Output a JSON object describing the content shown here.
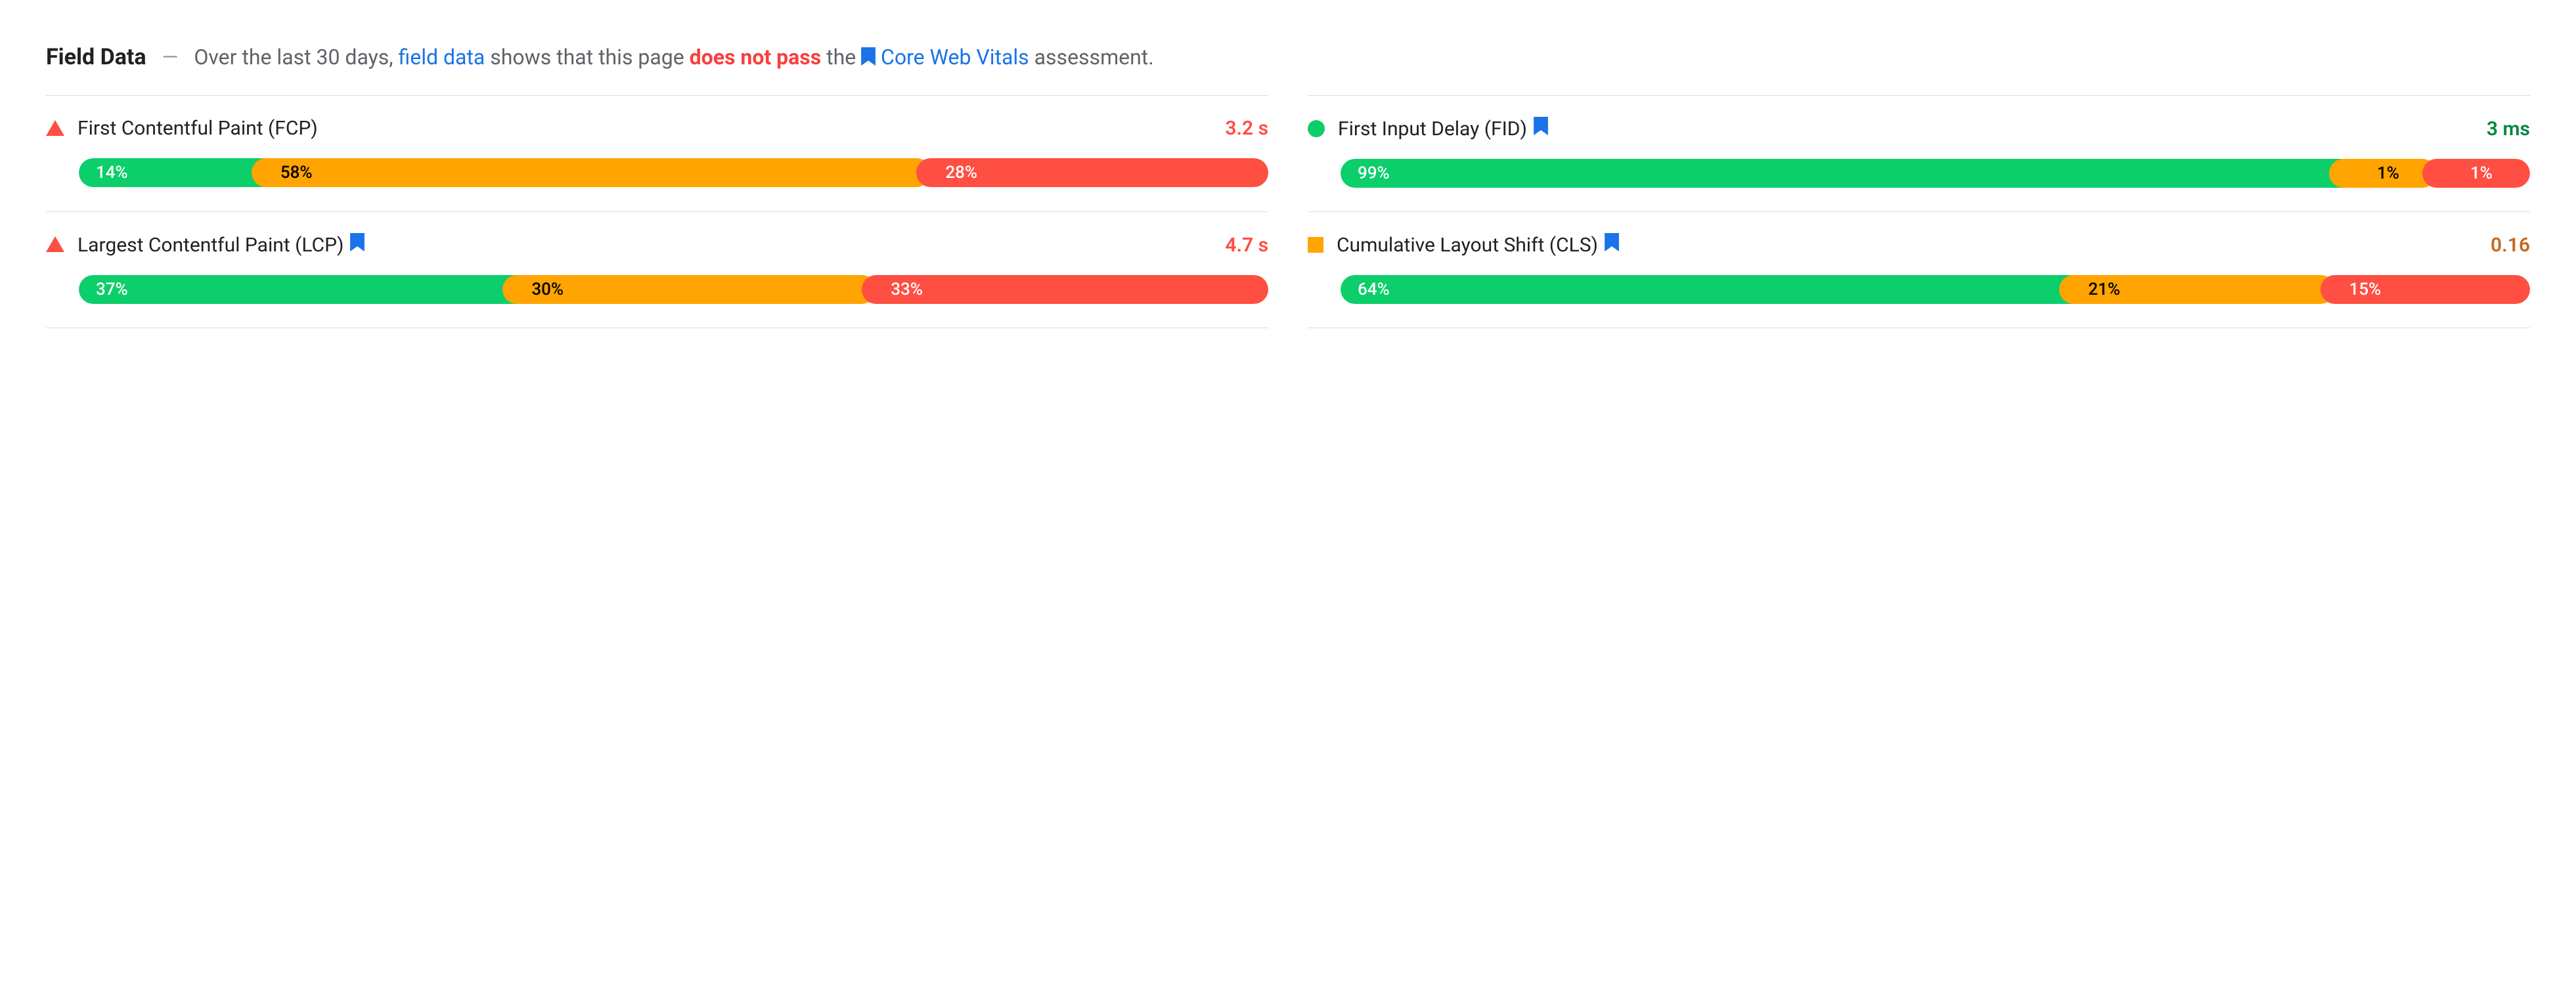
{
  "header": {
    "title": "Field Data",
    "prefix": "Over the last 30 days,",
    "link_field_data": "field data",
    "mid": "shows that this page",
    "status_text": "does not pass",
    "suffix": "the",
    "link_cwv": "Core Web Vitals",
    "tail": "assessment."
  },
  "metrics": [
    {
      "name": "First Contentful Paint (FCP)",
      "status": "poor",
      "value": "3.2 s",
      "value_class": "poor",
      "has_bookmark": false,
      "dist": {
        "good": "14%",
        "avg": "58%",
        "poor": "28%",
        "good_w": 14,
        "avg_w": 58,
        "poor_w": 28
      }
    },
    {
      "name": "First Input Delay (FID)",
      "status": "good",
      "value": "3 ms",
      "value_class": "good",
      "has_bookmark": true,
      "dist": {
        "good": "99%",
        "avg": "1%",
        "poor": "1%",
        "good_w": 86,
        "avg_w": 7,
        "poor_w": 7
      }
    },
    {
      "name": "Largest Contentful Paint (LCP)",
      "status": "poor",
      "value": "4.7 s",
      "value_class": "poor",
      "has_bookmark": true,
      "dist": {
        "good": "37%",
        "avg": "30%",
        "poor": "33%",
        "good_w": 37,
        "avg_w": 30,
        "poor_w": 33
      }
    },
    {
      "name": "Cumulative Layout Shift (CLS)",
      "status": "avg",
      "value": "0.16",
      "value_class": "avg",
      "has_bookmark": true,
      "dist": {
        "good": "64%",
        "avg": "21%",
        "poor": "15%",
        "good_w": 64,
        "avg_w": 21,
        "poor_w": 15
      }
    }
  ]
}
